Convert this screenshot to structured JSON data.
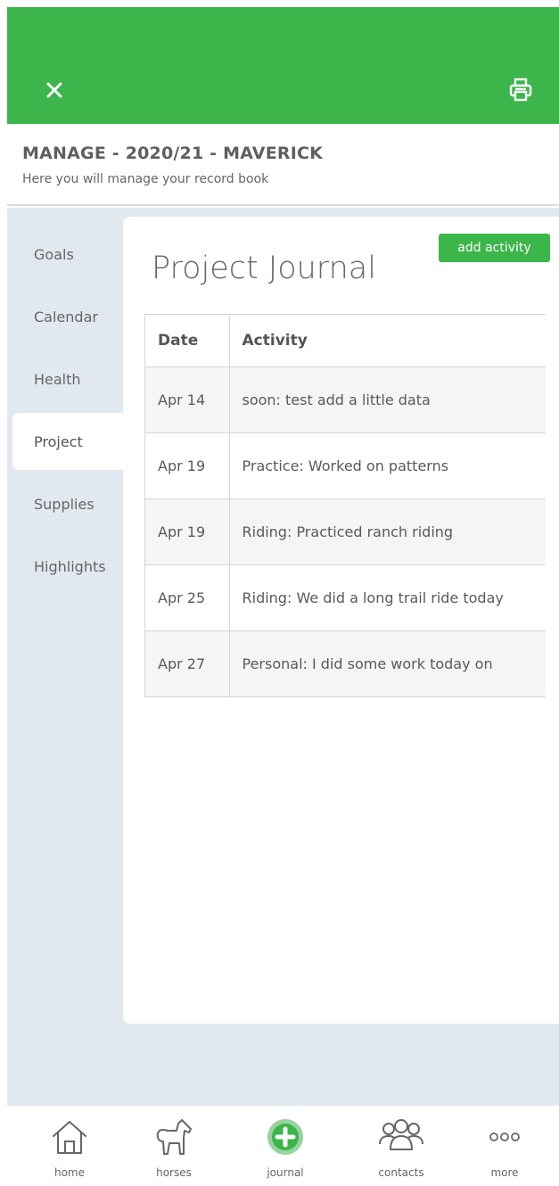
{
  "colors": {
    "brand_green": "#3cb54b",
    "sidebar_bg": "#e2e8ef"
  },
  "topbar": {
    "close_icon": "close-icon",
    "print_icon": "print-icon"
  },
  "header": {
    "title": "MANAGE - 2020/21 - MAVERICK",
    "subtitle": "Here you will manage your record book"
  },
  "sidebar": {
    "items": [
      {
        "label": "Goals",
        "active": false
      },
      {
        "label": "Calendar",
        "active": false
      },
      {
        "label": "Health",
        "active": false
      },
      {
        "label": "Project",
        "active": true
      },
      {
        "label": "Supplies",
        "active": false
      },
      {
        "label": "Highlights",
        "active": false
      }
    ]
  },
  "main": {
    "title": "Project Journal",
    "add_button_label": "add activity",
    "table": {
      "columns": [
        "Date",
        "Activity"
      ],
      "rows": [
        [
          "Apr 14",
          "soon: test add a little data"
        ],
        [
          "Apr 19",
          "Practice: Worked on patterns"
        ],
        [
          "Apr 19",
          "Riding: Practiced ranch riding"
        ],
        [
          "Apr 25",
          "Riding: We did a long trail ride today"
        ],
        [
          "Apr 27",
          "Personal: I did some work today on"
        ]
      ]
    }
  },
  "bottom_nav": {
    "tabs": [
      {
        "label": "home",
        "icon": "home-icon"
      },
      {
        "label": "horses",
        "icon": "horse-icon"
      },
      {
        "label": "journal",
        "icon": "plus-circle-icon"
      },
      {
        "label": "contacts",
        "icon": "people-icon"
      },
      {
        "label": "more",
        "icon": "more-icon"
      }
    ]
  }
}
